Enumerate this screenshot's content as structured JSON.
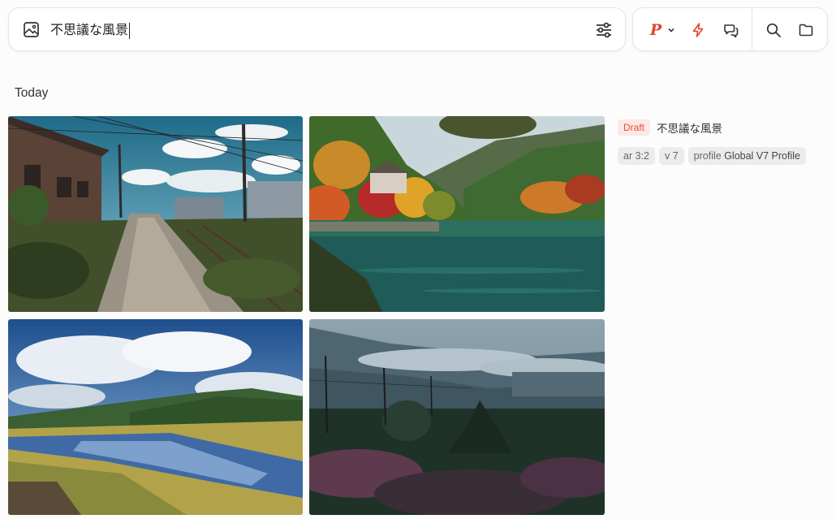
{
  "prompt": {
    "value": "不思議な風景",
    "icon": "image-icon",
    "settings_icon": "sliders-icon"
  },
  "toolbar": {
    "personalize_label": "P",
    "tools": [
      "lightning-icon",
      "chat-icon",
      "search-icon",
      "folder-icon"
    ],
    "accent_color": "#e0452a"
  },
  "section": {
    "title": "Today"
  },
  "job": {
    "status": "Draft",
    "prompt": "不思議な風景",
    "params": {
      "ar": "ar 3:2",
      "version": "v 7",
      "profile_key": "profile",
      "profile_value": "Global V7 Profile"
    }
  },
  "images": [
    "Rural dirt road with old houses, power lines and rail tracks",
    "Autumn lake with colorful trees and mountains",
    "River through green valley under dramatic clouds",
    "Misty hills with power towers and dark forest"
  ]
}
